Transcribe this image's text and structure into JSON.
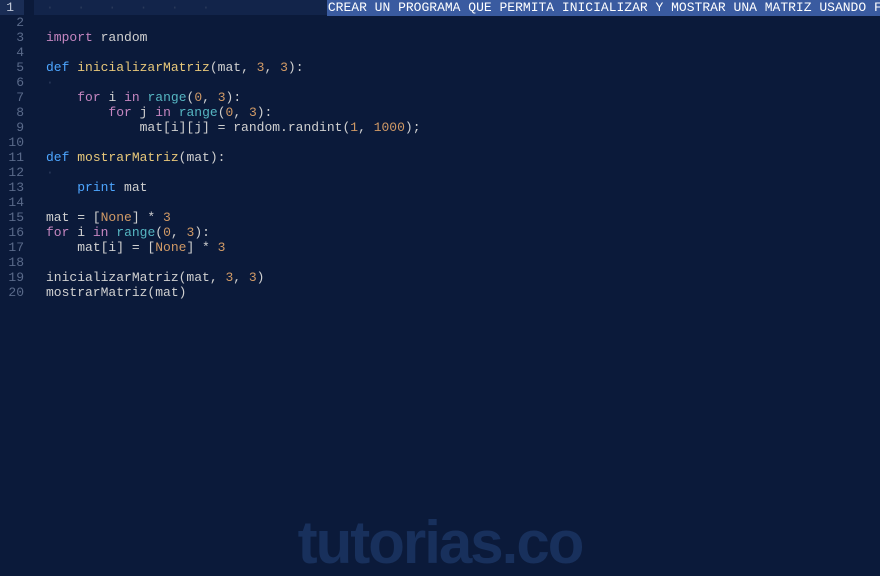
{
  "watermark": "tutorias.co",
  "gutter": [
    "1",
    "2",
    "3",
    "4",
    "5",
    "6",
    "7",
    "8",
    "9",
    "10",
    "11",
    "12",
    "13",
    "14",
    "15",
    "16",
    "17",
    "18",
    "19",
    "20"
  ],
  "current_line": 1,
  "code": {
    "l1_selected": "CREAR UN PROGRAMA QUE PERMITA INICIALIZAR Y MOSTRAR UNA MATRIZ USANDO FUNCIONES",
    "l3_import": "import",
    "l3_random": "random",
    "l5_def": "def",
    "l5_fn": "inicializarMatriz",
    "l5_params_open": "(",
    "l5_param1": "mat",
    "l5_comma": ", ",
    "l5_p2": "3",
    "l5_p3": "3",
    "l5_close": "):",
    "l7_for": "for",
    "l7_i": "i",
    "l7_in": "in",
    "l7_range": "range",
    "l7_open": "(",
    "l7_a": "0",
    "l7_b": "3",
    "l7_close": "):",
    "l8_for": "for",
    "l8_j": "j",
    "l8_in": "in",
    "l8_range": "range",
    "l8_a": "0",
    "l8_b": "3",
    "l9_assign": "mat[i][j] = random.randint(",
    "l9_a": "1",
    "l9_b": "1000",
    "l9_close": ");",
    "l11_def": "def",
    "l11_fn": "mostrarMatriz",
    "l11_params": "(mat):",
    "l13_print": "print",
    "l13_mat": "mat",
    "l15_mat": "mat = [",
    "l15_none": "None",
    "l15_close": "] * ",
    "l15_n": "3",
    "l16_for": "for",
    "l16_i": "i",
    "l16_in": "in",
    "l16_range": "range",
    "l16_a": "0",
    "l16_b": "3",
    "l16_close": "):",
    "l17_open": "mat[i] = [",
    "l17_none": "None",
    "l17_close": "] * ",
    "l17_n": "3",
    "l19_call1": "inicializarMatriz(mat, ",
    "l19_a": "3",
    "l19_b": "3",
    "l19_close": ")",
    "l20_call2": "mostrarMatriz(mat)"
  }
}
